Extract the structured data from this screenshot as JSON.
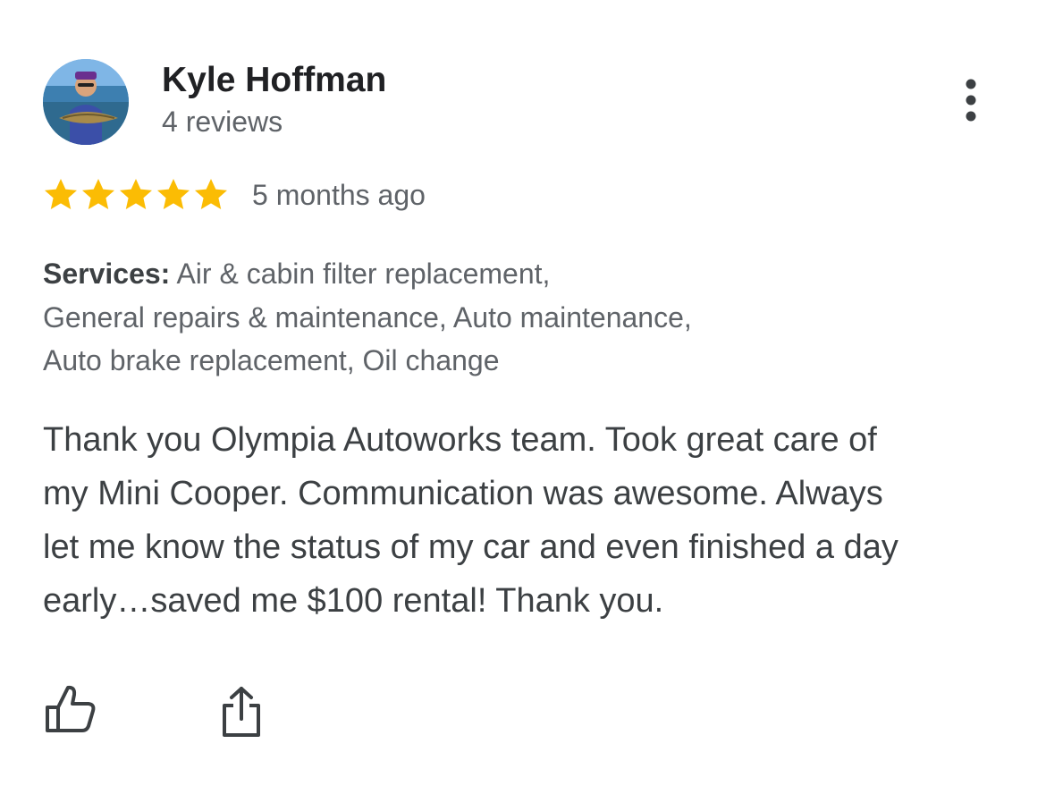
{
  "review": {
    "author_name": "Kyle Hoffman",
    "review_count": "4 reviews",
    "rating": 5,
    "rating_max": 5,
    "time_ago": "5 months ago",
    "services_label": "Services:",
    "services_lines": [
      " Air & cabin filter replacement,",
      "General repairs & maintenance, Auto maintenance,",
      "Auto brake replacement, Oil change"
    ],
    "text_lines": [
      "Thank you Olympia Autoworks team. Took great care of",
      "my Mini Cooper. Communication was awesome. Always",
      "let me know the status of my car and even finished a day",
      "early…saved me $100 rental! Thank you."
    ]
  },
  "icons": {
    "more": "more-vert-icon",
    "like": "thumbs-up-icon",
    "share": "share-icon",
    "star": "star-icon"
  },
  "colors": {
    "star": "#fbbc04",
    "name": "#202124",
    "secondary_text": "#5f6368",
    "body_text": "#3c4043",
    "icon": "#3c4043"
  }
}
